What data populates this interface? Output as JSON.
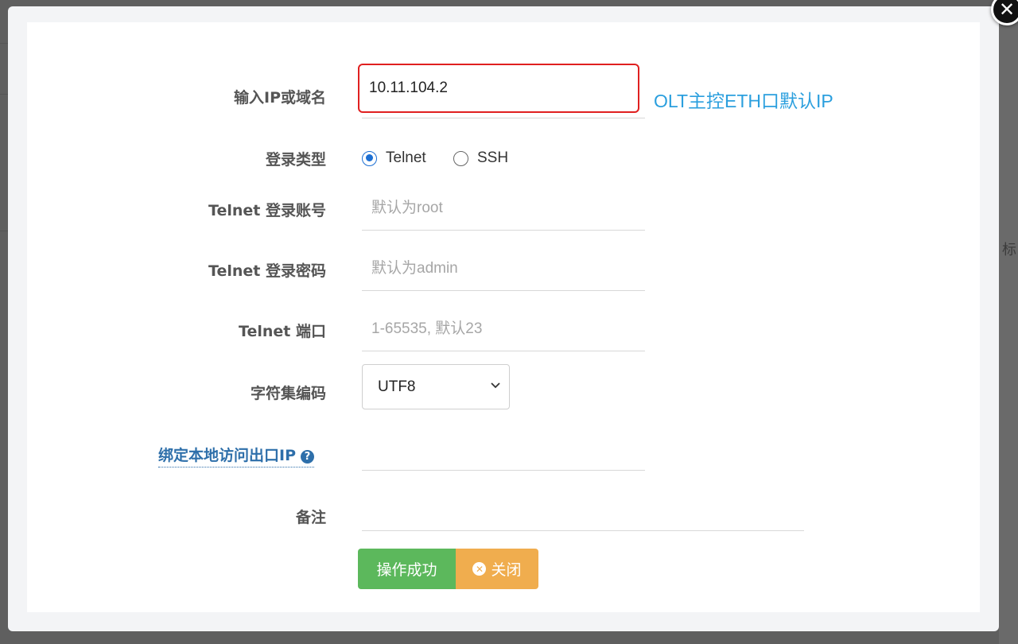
{
  "backdrop": {
    "side_text": "标"
  },
  "form": {
    "ip": {
      "label": "输入IP或域名",
      "value": "10.11.104.2",
      "hint": "OLT主控ETH口默认IP"
    },
    "login_type": {
      "label": "登录类型",
      "options": [
        "Telnet",
        "SSH"
      ],
      "selected": "Telnet"
    },
    "account": {
      "label": "Telnet 登录账号",
      "placeholder": "默认为root"
    },
    "password": {
      "label": "Telnet 登录密码",
      "placeholder": "默认为admin"
    },
    "port": {
      "label": "Telnet 端口",
      "placeholder": "1-65535, 默认23"
    },
    "charset": {
      "label": "字符集编码",
      "value": "UTF8"
    },
    "bind_ip": {
      "label": "绑定本地访问出口IP",
      "help_icon": "question-circle-icon"
    },
    "remark": {
      "label": "备注"
    }
  },
  "buttons": {
    "ok": "操作成功",
    "close": "关闭"
  },
  "colors": {
    "ok": "#5cb85c",
    "close": "#f0ad4e",
    "hint": "#2b9fde",
    "focus_border": "#e02020"
  }
}
